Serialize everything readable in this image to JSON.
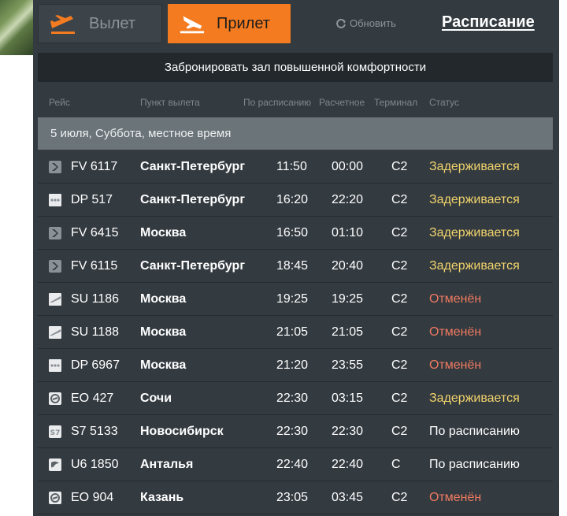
{
  "tabs": {
    "departure_label": "Вылет",
    "arrival_label": "Прилет"
  },
  "refresh_label": "Обновить",
  "schedule_link": "Расписание",
  "lounge_banner": "Забронировать зал повышенной комфортности",
  "columns": {
    "flight": "Рейс",
    "origin": "Пункт вылета",
    "scheduled": "По расписанию",
    "estimated": "Расчетное",
    "terminal": "Терминал",
    "status": "Статус"
  },
  "date_header": "5 июля, Суббота, местное время",
  "colors": {
    "accent": "#f47b20",
    "delayed": "#f2d46c",
    "cancelled": "#f07a5f",
    "on_time": "#ffffff"
  },
  "flights": [
    {
      "logo": "rossiya-logo-icon",
      "flight": "FV 6117",
      "city": "Санкт-Петербург",
      "scheduled": "11:50",
      "estimated": "00:00",
      "terminal": "C2",
      "status": "Задерживается",
      "status_type": "delayed"
    },
    {
      "logo": "pobeda-logo-icon",
      "flight": "DP 517",
      "city": "Санкт-Петербург",
      "scheduled": "16:20",
      "estimated": "22:20",
      "terminal": "C2",
      "status": "Задерживается",
      "status_type": "delayed"
    },
    {
      "logo": "rossiya-logo-icon",
      "flight": "FV 6415",
      "city": "Москва",
      "scheduled": "16:50",
      "estimated": "01:10",
      "terminal": "C2",
      "status": "Задерживается",
      "status_type": "delayed"
    },
    {
      "logo": "rossiya-logo-icon",
      "flight": "FV 6115",
      "city": "Санкт-Петербург",
      "scheduled": "18:45",
      "estimated": "20:40",
      "terminal": "C2",
      "status": "Задерживается",
      "status_type": "delayed"
    },
    {
      "logo": "aeroflot-logo-icon",
      "flight": "SU 1186",
      "city": "Москва",
      "scheduled": "19:25",
      "estimated": "19:25",
      "terminal": "C2",
      "status": "Отменён",
      "status_type": "cancelled"
    },
    {
      "logo": "aeroflot-logo-icon",
      "flight": "SU 1188",
      "city": "Москва",
      "scheduled": "21:05",
      "estimated": "21:05",
      "terminal": "C2",
      "status": "Отменён",
      "status_type": "cancelled"
    },
    {
      "logo": "pobeda-logo-icon",
      "flight": "DP 6967",
      "city": "Москва",
      "scheduled": "21:20",
      "estimated": "23:55",
      "terminal": "C2",
      "status": "Отменён",
      "status_type": "cancelled"
    },
    {
      "logo": "pegas-logo-icon",
      "flight": "EO 427",
      "city": "Сочи",
      "scheduled": "22:30",
      "estimated": "03:15",
      "terminal": "C2",
      "status": "Задерживается",
      "status_type": "delayed"
    },
    {
      "logo": "s7-logo-icon",
      "flight": "S7 5133",
      "city": "Новосибирск",
      "scheduled": "22:30",
      "estimated": "22:30",
      "terminal": "C2",
      "status": "По расписанию",
      "status_type": "on_time"
    },
    {
      "logo": "ural-logo-icon",
      "flight": "U6 1850",
      "city": "Анталья",
      "scheduled": "22:40",
      "estimated": "22:40",
      "terminal": "C",
      "status": "По расписанию",
      "status_type": "on_time"
    },
    {
      "logo": "pegas-logo-icon",
      "flight": "EO 904",
      "city": "Казань",
      "scheduled": "23:05",
      "estimated": "03:45",
      "terminal": "C2",
      "status": "Отменён",
      "status_type": "cancelled"
    }
  ]
}
